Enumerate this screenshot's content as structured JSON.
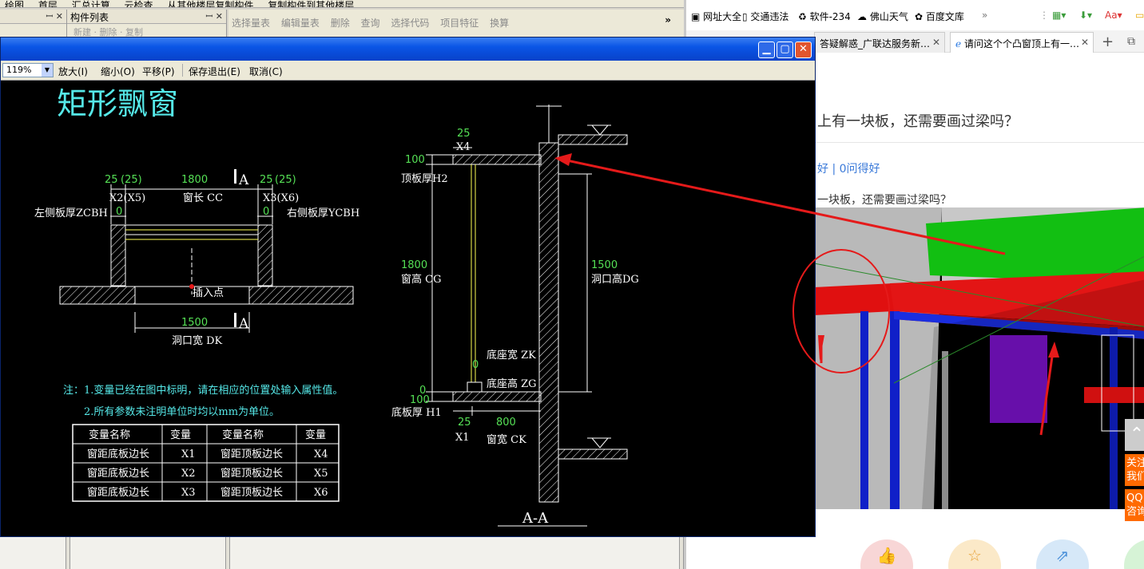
{
  "background_app": {
    "toolbar_items": [
      "绘图",
      "首层",
      "汇总计算",
      "云检查",
      "从其他楼层复制构件",
      "复制构件到其他楼层"
    ],
    "panel_left_title": "",
    "panel_mid_title": "构件列表",
    "panel_mid_tools": "新建 · 删除 · 复制",
    "toolbar2": [
      "选择量表",
      "编辑量表",
      "删除",
      "查询",
      "选择代码",
      "项目特征",
      "换算"
    ],
    "chevron": "»"
  },
  "browser": {
    "bookmarks": [
      "网址大全",
      "交通违法",
      "软件-234",
      "佛山天气",
      "百度文库"
    ],
    "tabs": [
      {
        "label": "答疑解惑_广联达服务新…",
        "active": false
      },
      {
        "label": "请问这个个凸窗顶上有一…",
        "active": true
      }
    ],
    "new_tab": "+",
    "page_title": "上有一块板，还需要画过梁吗？",
    "stats": "好 | 0问得好",
    "question": "一块板，还需要画过梁吗？",
    "side_buttons": [
      "关注我们",
      "QQ咨询"
    ]
  },
  "dialog": {
    "zoom_value": "119%",
    "toolbar": [
      "放大(I)",
      "缩小(O)",
      "平移(P)",
      "保存退出(E)",
      "取消(C)"
    ]
  },
  "drawing": {
    "title": "矩形飘窗",
    "plan": {
      "dim_25_a": "25",
      "dim_25_a_paren": "(25)",
      "dim_1800": "1800",
      "dim_25_b": "25",
      "dim_25_b_paren": "(25)",
      "section_mark_top": "A",
      "section_mark_bottom": "A",
      "x2": "X2(X5)",
      "window_length": "窗长 CC",
      "x3": "X3(X6)",
      "left_thickness": "左侧板厚ZCBH",
      "right_thickness": "右侧板厚YCBH",
      "zero_left": "0",
      "zero_right": "0",
      "insert_point": "插入点",
      "dim_1500": "1500",
      "opening_width": "洞口宽 DK"
    },
    "notes": [
      "注：1.变量已经在图中标明，请在相应的位置处输入属性值。",
      "2.所有参数未注明单位时均以mm为单位。"
    ],
    "table": {
      "headers": [
        "变量名称",
        "变量",
        "变量名称",
        "变量"
      ],
      "rows": [
        [
          "窗距底板边长",
          "X1",
          "窗距顶板边长",
          "X4"
        ],
        [
          "窗距底板边长",
          "X2",
          "窗距顶板边长",
          "X5"
        ],
        [
          "窗距底板边长",
          "X3",
          "窗距顶板边长",
          "X6"
        ]
      ]
    },
    "section": {
      "dim_25_top": "25",
      "x4": "X4",
      "dim_100_top": "100",
      "top_thickness": "顶板厚H2",
      "dim_1800": "1800",
      "window_height": "窗高 CG",
      "dim_1500": "1500",
      "opening_height": "洞口高DG",
      "zero_zk": "0",
      "base_width": "底座宽 ZK",
      "zero_zg": "0",
      "base_height": "底座高 ZG",
      "dim_100_bottom": "100",
      "bottom_thickness": "底板厚 H1",
      "dim_25_bottom": "25",
      "dim_800": "800",
      "x1": "X1",
      "window_width": "窗宽 CK",
      "section_label": "A-A"
    }
  },
  "colors": {
    "cad_bg": "#000000",
    "dim_green": "#55e055",
    "title_cyan": "#55e8e8",
    "annotation_red": "#e51a1a",
    "xp_blue": "#0a55e6"
  }
}
